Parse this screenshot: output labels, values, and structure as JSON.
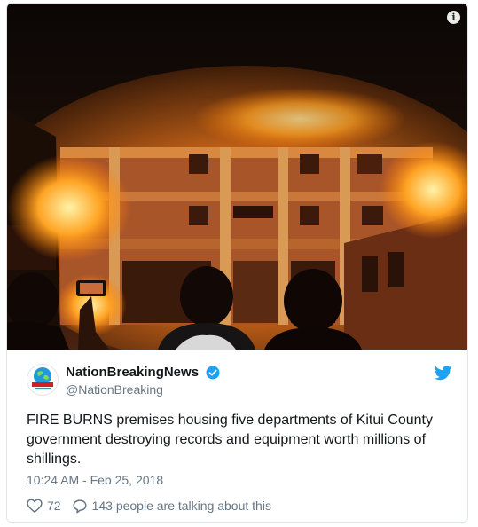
{
  "tweet": {
    "display_name": "NationBreakingNews",
    "handle": "@NationBreaking",
    "text": "FIRE BURNS premises housing five departments of Kitui County government destroying records and equipment worth millions of shillings.",
    "timestamp": "10:24 AM - Feb 25, 2018",
    "likes": "72",
    "talking": "143 people are talking about this",
    "media_info_glyph": "i"
  },
  "colors": {
    "twitter_blue": "#1da1f2",
    "secondary_text": "#657786",
    "primary_text": "#14171a",
    "border": "#e1e8ed"
  },
  "icons": {
    "info": "info-icon",
    "verified": "verified-badge-icon",
    "bird": "twitter-bird-icon",
    "like": "heart-icon",
    "reply": "speech-bubble-icon",
    "avatar": "nation-globe-logo"
  }
}
